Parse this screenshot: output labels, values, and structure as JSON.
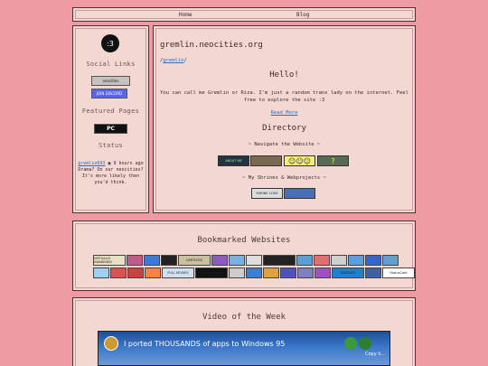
{
  "nav": {
    "home": "Home",
    "blog": "Blog"
  },
  "side": {
    "avatar": ":3",
    "social_heading": "Social Links",
    "social_badges": [
      "neocities",
      "JOIN DISCORD"
    ],
    "featured_heading": "Featured Pages",
    "featured_badge": "PC",
    "status_heading": "Status",
    "status_user": "gremlin693",
    "status_time": "9 hours ago",
    "status_text": "Drama? On our neocities? It's more likely then you'd think."
  },
  "main": {
    "title": "gremlin.neocities.org",
    "crumb_pre": "/",
    "crumb_link": "gremlin",
    "crumb_post": "/",
    "hello": "Hello!",
    "intro": "You can call me Gremlin or Riza. I'm just a random trans lady on the internet. Feel free to explore the site :3",
    "read_more": "Read More",
    "directory": "Directory",
    "navigate": "~ Navigate the Website ~",
    "nav_buttons": [
      "ABOUT ME",
      "",
      "",
      ""
    ],
    "shrines": "~ My Shrines & Webprojects ~",
    "shrine_buttons": [
      "SHRINE CODE",
      ""
    ]
  },
  "bookmarks": {
    "heading": "Bookmarked Websites",
    "row1": [
      "VIRTUALLY AWAKENED",
      "",
      "",
      "",
      "LIMITLESS",
      "",
      "",
      "",
      "BLEED YOUR ...",
      "",
      "",
      "",
      "",
      "",
      ""
    ],
    "row2": [
      "",
      "",
      "",
      "",
      "FULL MOVIES",
      "SILICON GIRL",
      "",
      "",
      "",
      "",
      "",
      "",
      "DIGERATI",
      "",
      "StatusCafe"
    ]
  },
  "video": {
    "heading": "Video of the Week",
    "title": "I ported THOUSANDS of apps to Windows 95",
    "side_text": "Copy li..."
  },
  "colors": {
    "background": "#ee9aa2",
    "panel": "#f3d7d1",
    "link": "#2a6fc4"
  }
}
